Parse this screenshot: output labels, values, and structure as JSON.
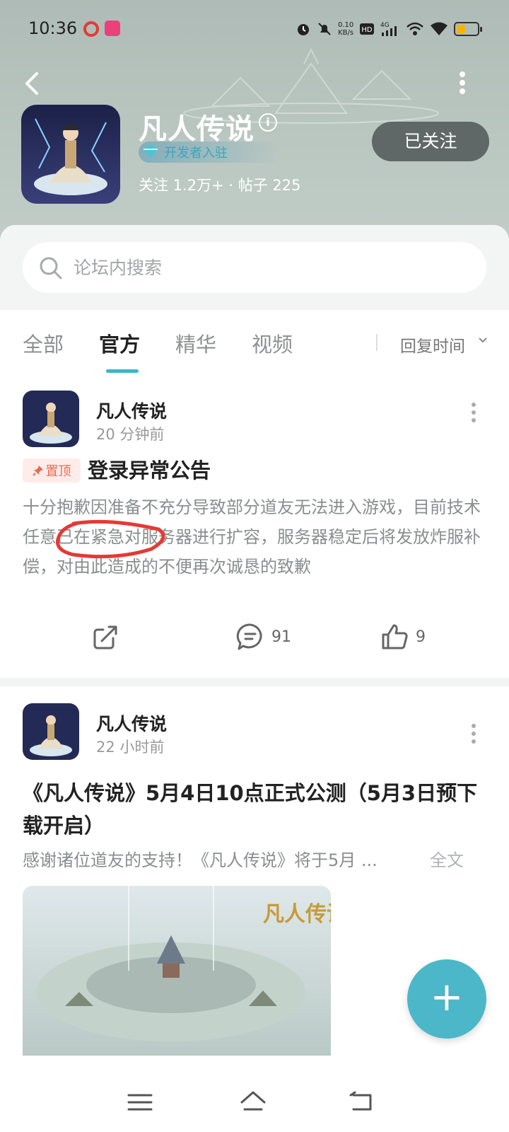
{
  "status_bar": {
    "time": "10:36",
    "net_speed_value": "0.10",
    "net_speed_unit": "KB/s",
    "network": "4G",
    "hd": "HD"
  },
  "forum": {
    "title": "凡人传说",
    "info_icon": "i",
    "developer_badge": "开发者入驻",
    "stats": "关注 1.2万+  ·  帖子 225",
    "follow_label": "已关注"
  },
  "search": {
    "placeholder": "论坛内搜索"
  },
  "tabs": [
    {
      "label": "全部",
      "active": false
    },
    {
      "label": "官方",
      "active": true
    },
    {
      "label": "精华",
      "active": false
    },
    {
      "label": "视频",
      "active": false
    }
  ],
  "sort": {
    "label": "回复时间"
  },
  "posts": [
    {
      "author": "凡人传说",
      "time": "20 分钟前",
      "pin_label": "置顶",
      "title": "登录异常公告",
      "body": "十分抱歉因准备不充分导致部分道友无法进入游戏，目前技术任意已在紧急对服务器进行扩容，服务器稳定后将发放炸服补偿，对由此造成的不便再次诚恳的致歉",
      "comments": "91",
      "likes": "9"
    },
    {
      "author": "凡人传说",
      "time": "22 小时前",
      "title": "《凡人传说》5月4日10点正式公测（5月3日预下载开启）",
      "excerpt": "感谢诸位道友的支持！《凡人传说》将于5月 ...",
      "full_text_label": "全文",
      "image_logo_text": "凡人传说"
    }
  ],
  "fab": {
    "label": "+"
  },
  "colors": {
    "accent": "#3fb5c7",
    "fab": "#4cb7c8",
    "follow_button": "#5f6866",
    "pin_text": "#e96c50"
  },
  "icons": [
    "back-icon",
    "more-icon",
    "info-icon",
    "diamond-icon",
    "search-icon",
    "chevron-down-icon",
    "pin-icon",
    "share-icon",
    "comment-icon",
    "like-icon",
    "menu-icon",
    "home-icon",
    "return-icon",
    "plus-icon"
  ]
}
